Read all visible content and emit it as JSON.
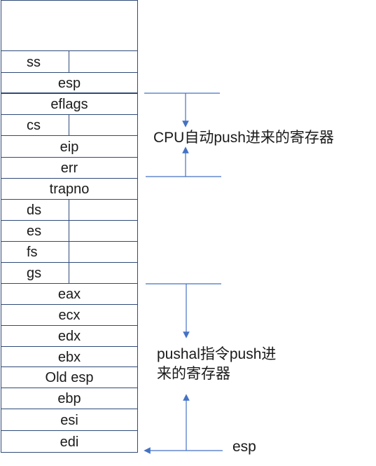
{
  "stack": {
    "slots": [
      {
        "label": "ss",
        "kind": "half"
      },
      {
        "label": "esp",
        "kind": "full"
      },
      {
        "label": "eflags",
        "kind": "full"
      },
      {
        "label": "cs",
        "kind": "half"
      },
      {
        "label": "eip",
        "kind": "full"
      },
      {
        "label": "err",
        "kind": "full"
      },
      {
        "label": "trapno",
        "kind": "full"
      },
      {
        "label": "ds",
        "kind": "half"
      },
      {
        "label": "es",
        "kind": "half"
      },
      {
        "label": "fs",
        "kind": "half"
      },
      {
        "label": "gs",
        "kind": "half"
      },
      {
        "label": "eax",
        "kind": "full"
      },
      {
        "label": "ecx",
        "kind": "full"
      },
      {
        "label": "edx",
        "kind": "full"
      },
      {
        "label": "ebx",
        "kind": "full"
      },
      {
        "label": "Old esp",
        "kind": "full"
      },
      {
        "label": "ebp",
        "kind": "full"
      },
      {
        "label": "esi",
        "kind": "full"
      },
      {
        "label": "edi",
        "kind": "full"
      }
    ]
  },
  "annotations": {
    "cpu_push": "CPU自动push进来的寄存器",
    "pushal_line1": "pushal指令push进",
    "pushal_line2": "来的寄存器",
    "esp_pointer": "esp"
  },
  "colors": {
    "line": "#2f4a78",
    "arrow": "#4472c4"
  }
}
